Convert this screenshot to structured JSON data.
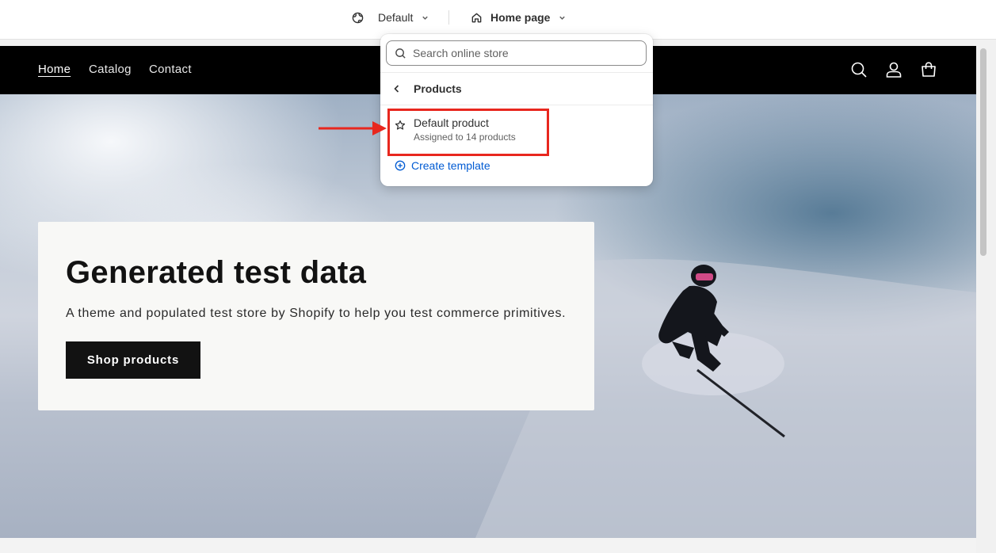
{
  "editor_bar": {
    "theme_selector": {
      "label": "Default",
      "icon": "globe-icon"
    },
    "page_selector": {
      "label": "Home page",
      "icon": "home-icon"
    }
  },
  "store": {
    "nav": [
      {
        "label": "Home",
        "active": true
      },
      {
        "label": "Catalog",
        "active": false
      },
      {
        "label": "Contact",
        "active": false
      }
    ],
    "header_icons": [
      "search-icon",
      "account-icon",
      "cart-icon"
    ],
    "hero": {
      "title": "Generated test data",
      "subtitle": "A theme and populated test store by Shopify to help you test commerce primitives.",
      "button_label": "Shop products"
    }
  },
  "popover": {
    "search_placeholder": "Search online store",
    "section_title": "Products",
    "templates": [
      {
        "name": "Default product",
        "meta": "Assigned to 14 products",
        "icon": "star-icon"
      }
    ],
    "create_label": "Create template"
  },
  "colors": {
    "accent": "#005bd3",
    "annotation": "#e8271e",
    "store_header": "#000000",
    "hero_button": "#121212"
  }
}
